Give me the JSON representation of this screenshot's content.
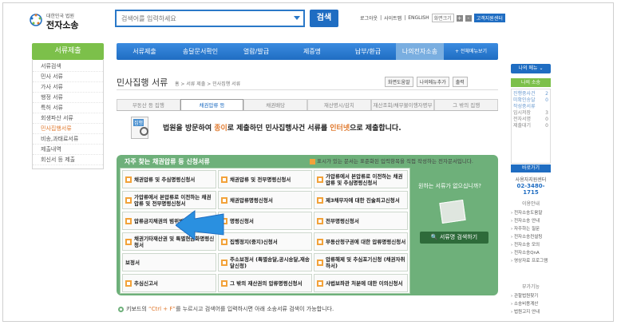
{
  "header": {
    "logo_small": "대한민국 법원",
    "logo_big": "전자소송",
    "search_placeholder": "검색어를 입력하세요",
    "search_button": "검색",
    "util": {
      "login": "로그아웃",
      "sitemap_link": "사이트맵",
      "english": "ENGLISH",
      "zoom_label": "화면크기",
      "zoom_plus": "+",
      "zoom_minus": "-",
      "customer": "고객지원센터"
    }
  },
  "sidebar": {
    "title": "서류제출",
    "items": [
      {
        "label": "서류검색"
      },
      {
        "label": "민사 서류"
      },
      {
        "label": "가사 서류"
      },
      {
        "label": "행정 서류"
      },
      {
        "label": "특허 서류"
      },
      {
        "label": "회생파산 서류"
      },
      {
        "label": "민사집행서류"
      },
      {
        "label": "비송,과태료서류"
      },
      {
        "label": "제출내역"
      },
      {
        "label": "회신서 등 제출"
      }
    ]
  },
  "gnb": {
    "items": [
      {
        "label": "서류제출"
      },
      {
        "label": "송달문서확인"
      },
      {
        "label": "열람/발급"
      },
      {
        "label": "제증명"
      },
      {
        "label": "납부/환급"
      },
      {
        "label": "나의전자소송"
      },
      {
        "label": "+ 전체메뉴보기"
      }
    ]
  },
  "page": {
    "title": "민사집행 서류",
    "breadcrumb": "홈 > 서류 제출 > 민사집행 서류",
    "tools": {
      "help": "화면도움말",
      "my_menu": "나의메뉴추가",
      "print": "출력"
    }
  },
  "tabs": [
    "부동산 등 집행",
    "채권압류 등",
    "채권배당",
    "재산명시/감치",
    "재산조회/채무불이행자명부",
    "그 밖의 집행"
  ],
  "intro": {
    "icon_label": "집행",
    "t1": "법원을 방문하여 ",
    "t2": "종이",
    "t3": "로 제출하던 민사집행사건 서류를 ",
    "t4": "인터넷",
    "t5": "으로 제출합니다."
  },
  "frequent": {
    "title": "자주 찾는 채권압류 등 신청서류",
    "note": "표시가 있는 문서는 표준화된 입력항목을 직접 작성하는 전자문서입니다.",
    "cells": [
      {
        "text": "채권압류 및 추심명령신청서"
      },
      {
        "text": "채권압류 및 전부명령신청서"
      },
      {
        "text": "가압류에서 본압류로 이전하는 채권압류 및 추심명령신청서"
      },
      {
        "text": "가압류에서 본압류로 이전하는 채권압류 및 전부명령신청서"
      },
      {
        "text": "채권압류명령신청서"
      },
      {
        "text": "제3채무자에 대한 진술최고신청서"
      },
      {
        "text": "압류금지채권의 범위변경신청서"
      },
      {
        "text": "명령신청서"
      },
      {
        "text": "전부명령신청서"
      },
      {
        "text": "채권기타재산권 및 특별현금화명령신청서"
      },
      {
        "text": "집행정지(중지)신청서"
      },
      {
        "text": "부동산청구권에 대한 압류명령신청서"
      },
      {
        "text": "보정서"
      },
      {
        "text": "주소보정서 (특별송달,공시송달,재송달신청)"
      },
      {
        "text": "압류해제 및 추심포기신청 (채권자취하서)"
      },
      {
        "text": "추심신고서"
      },
      {
        "text": "그 밖의 재산권의 압류명령신청서"
      },
      {
        "text": "사법보좌관 처분에 대한 이의신청서"
      }
    ],
    "right_question": "원하는 서류가 없으십니까?",
    "right_button": "서류명 검색하기"
  },
  "tip": {
    "t1": "키보드의 ",
    "key": "“Ctrl + F”",
    "t2": "를 누르시고 검색어를 입력하시면 아래 소송서류 검색이 가능합니다."
  },
  "right": {
    "my_menu": "나의 메뉴",
    "my_sosong": "나의 소송",
    "rows": [
      {
        "label": "진행중사건",
        "val": "2"
      },
      {
        "label": "미확인송달",
        "val": "0"
      },
      {
        "label": "작성중서류",
        "val": ""
      },
      {
        "label": "임시저장",
        "val": "3"
      },
      {
        "label": "전자서명",
        "val": "0"
      },
      {
        "label": "제출대기",
        "val": "0"
      }
    ],
    "call_head": "바로가기",
    "call_1": "사용자지원센터",
    "call_2": "02-3480-1715",
    "guide": "이용안내",
    "links1": [
      "전자소송도움말",
      "전자소송 안내",
      "자주하는 질문",
      "전자소송컨설팅",
      "전자소송 모의",
      "전자소송QnA",
      "영상자료 프로그램"
    ],
    "etc": "부가기능",
    "links2": [
      "관할법원찾기",
      "소송비용계산",
      "법원고지 안내"
    ]
  }
}
